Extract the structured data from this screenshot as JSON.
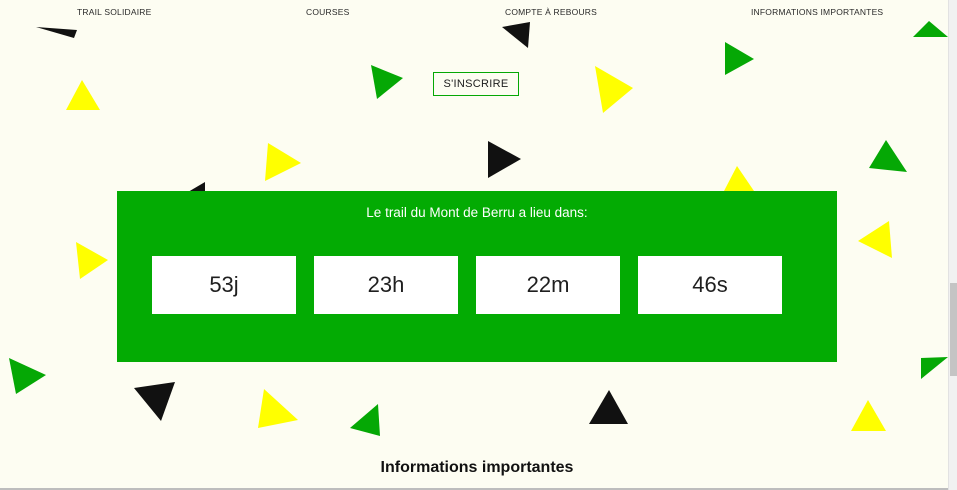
{
  "nav": {
    "items": [
      {
        "label": "TRAIL SOLIDAIRE"
      },
      {
        "label": "COURSES"
      },
      {
        "label": "COMPTE À REBOURS"
      },
      {
        "label": "INFORMATIONS IMPORTANTES"
      }
    ]
  },
  "signup_label": "S'INSCRIRE",
  "countdown": {
    "title": "Le trail du Mont de Berru a lieu dans:",
    "days": "53j",
    "hours": "23h",
    "minutes": "22m",
    "seconds": "46s"
  },
  "section_heading": "Informations importantes",
  "colors": {
    "accent_green": "#03ab03",
    "yellow": "#ffff00",
    "black": "#111111",
    "background": "#fdfdf2"
  }
}
